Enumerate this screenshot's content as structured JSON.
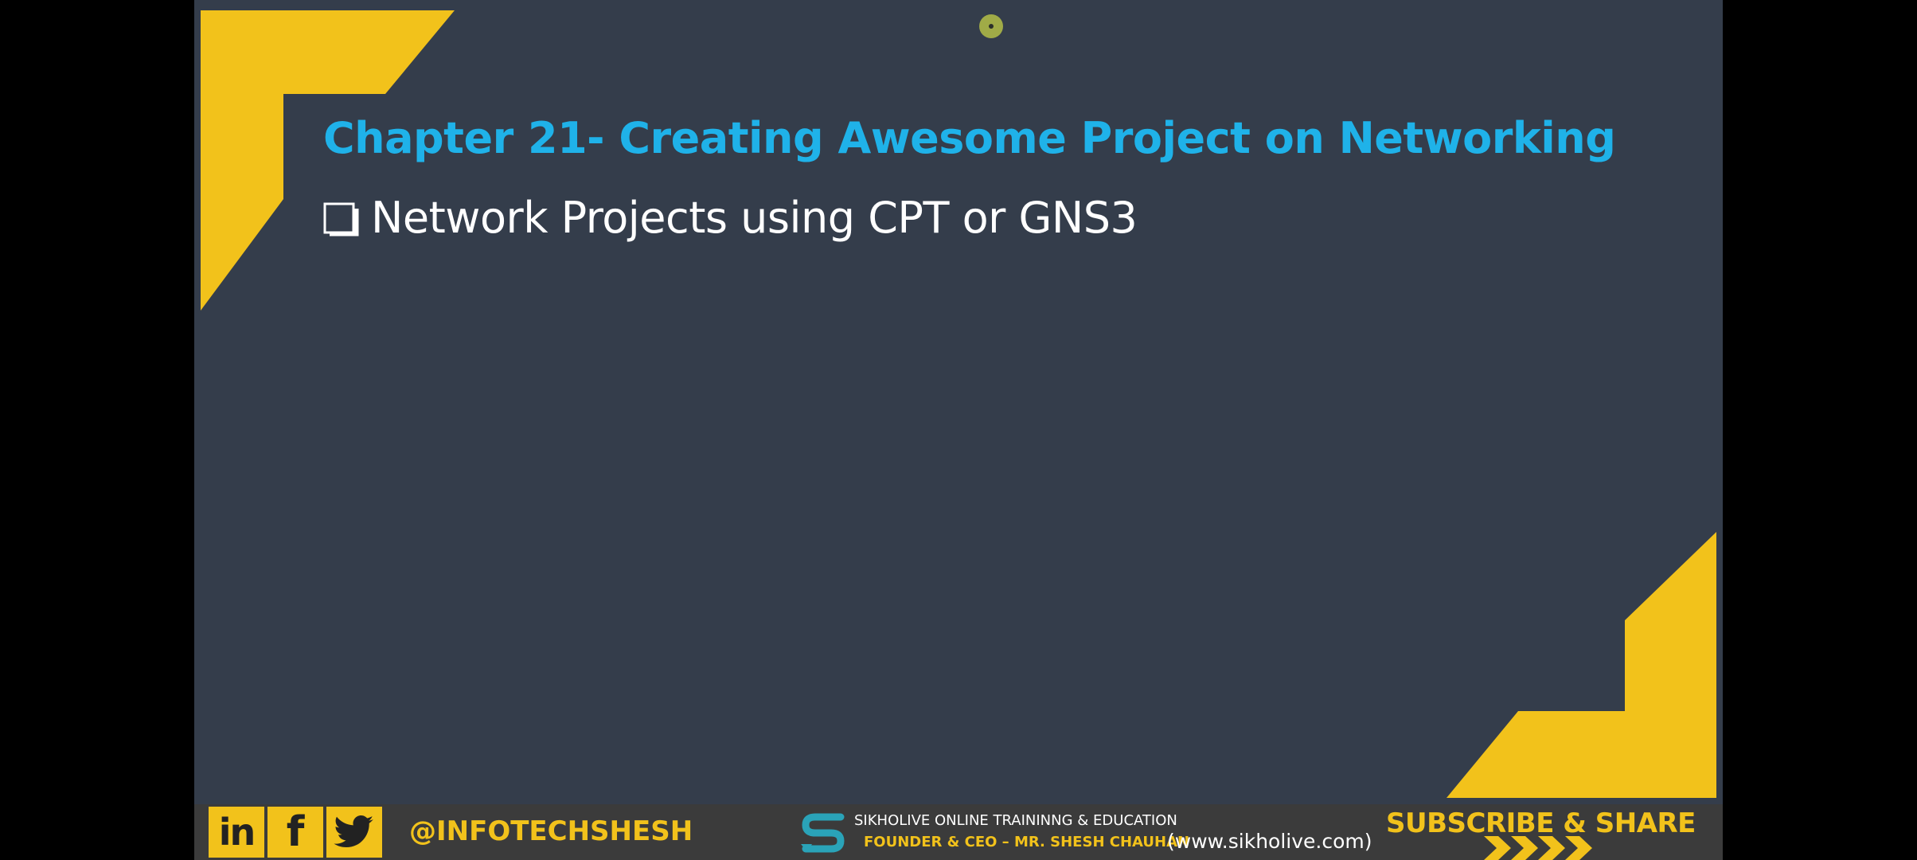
{
  "slide": {
    "title": "Chapter 21- Creating Awesome Project on Networking",
    "bullets": [
      {
        "text": "Network Projects using CPT or GNS3"
      }
    ]
  },
  "footer": {
    "social_icons": [
      "linkedin-icon",
      "facebook-icon",
      "twitter-icon"
    ],
    "linkedin_label": "in",
    "facebook_label": "f",
    "handle": "@INFOTECHSHESH",
    "company": "SIKHOLIVE ONLINE TRAININNG & EDUCATION",
    "founder": "FOUNDER & CEO – MR. SHESH CHAUHAN",
    "website": "(www.sikholive.com)",
    "subscribe": "SUBSCRIBE & SHARE"
  },
  "colors": {
    "slide_background": "#343d4b",
    "accent_yellow": "#f2c21b",
    "title_blue": "#1fb2e9",
    "footer_background": "#3b3b3b",
    "logo_teal": "#2aa3b8"
  }
}
